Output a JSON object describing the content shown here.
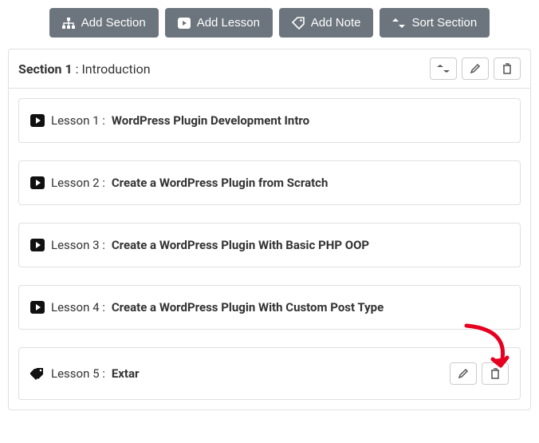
{
  "toolbar": {
    "add_section": "Add Section",
    "add_lesson": "Add Lesson",
    "add_note": "Add Note",
    "sort_section": "Sort Section"
  },
  "section": {
    "prefix": "Section 1",
    "sep": " : ",
    "title": "Introduction"
  },
  "lessons": [
    {
      "icon": "play",
      "prefix": "Lesson 1 : ",
      "name": "WordPress Plugin Development Intro",
      "actions": false
    },
    {
      "icon": "play",
      "prefix": "Lesson 2 : ",
      "name": "Create a WordPress Plugin from Scratch",
      "actions": false
    },
    {
      "icon": "play",
      "prefix": "Lesson 3 : ",
      "name": "Create a WordPress Plugin With Basic PHP OOP",
      "actions": false
    },
    {
      "icon": "play",
      "prefix": "Lesson 4 : ",
      "name": "Create a WordPress Plugin With Custom Post Type",
      "actions": false
    },
    {
      "icon": "note",
      "prefix": "Lesson 5 : ",
      "name": "Extar",
      "actions": true
    }
  ]
}
